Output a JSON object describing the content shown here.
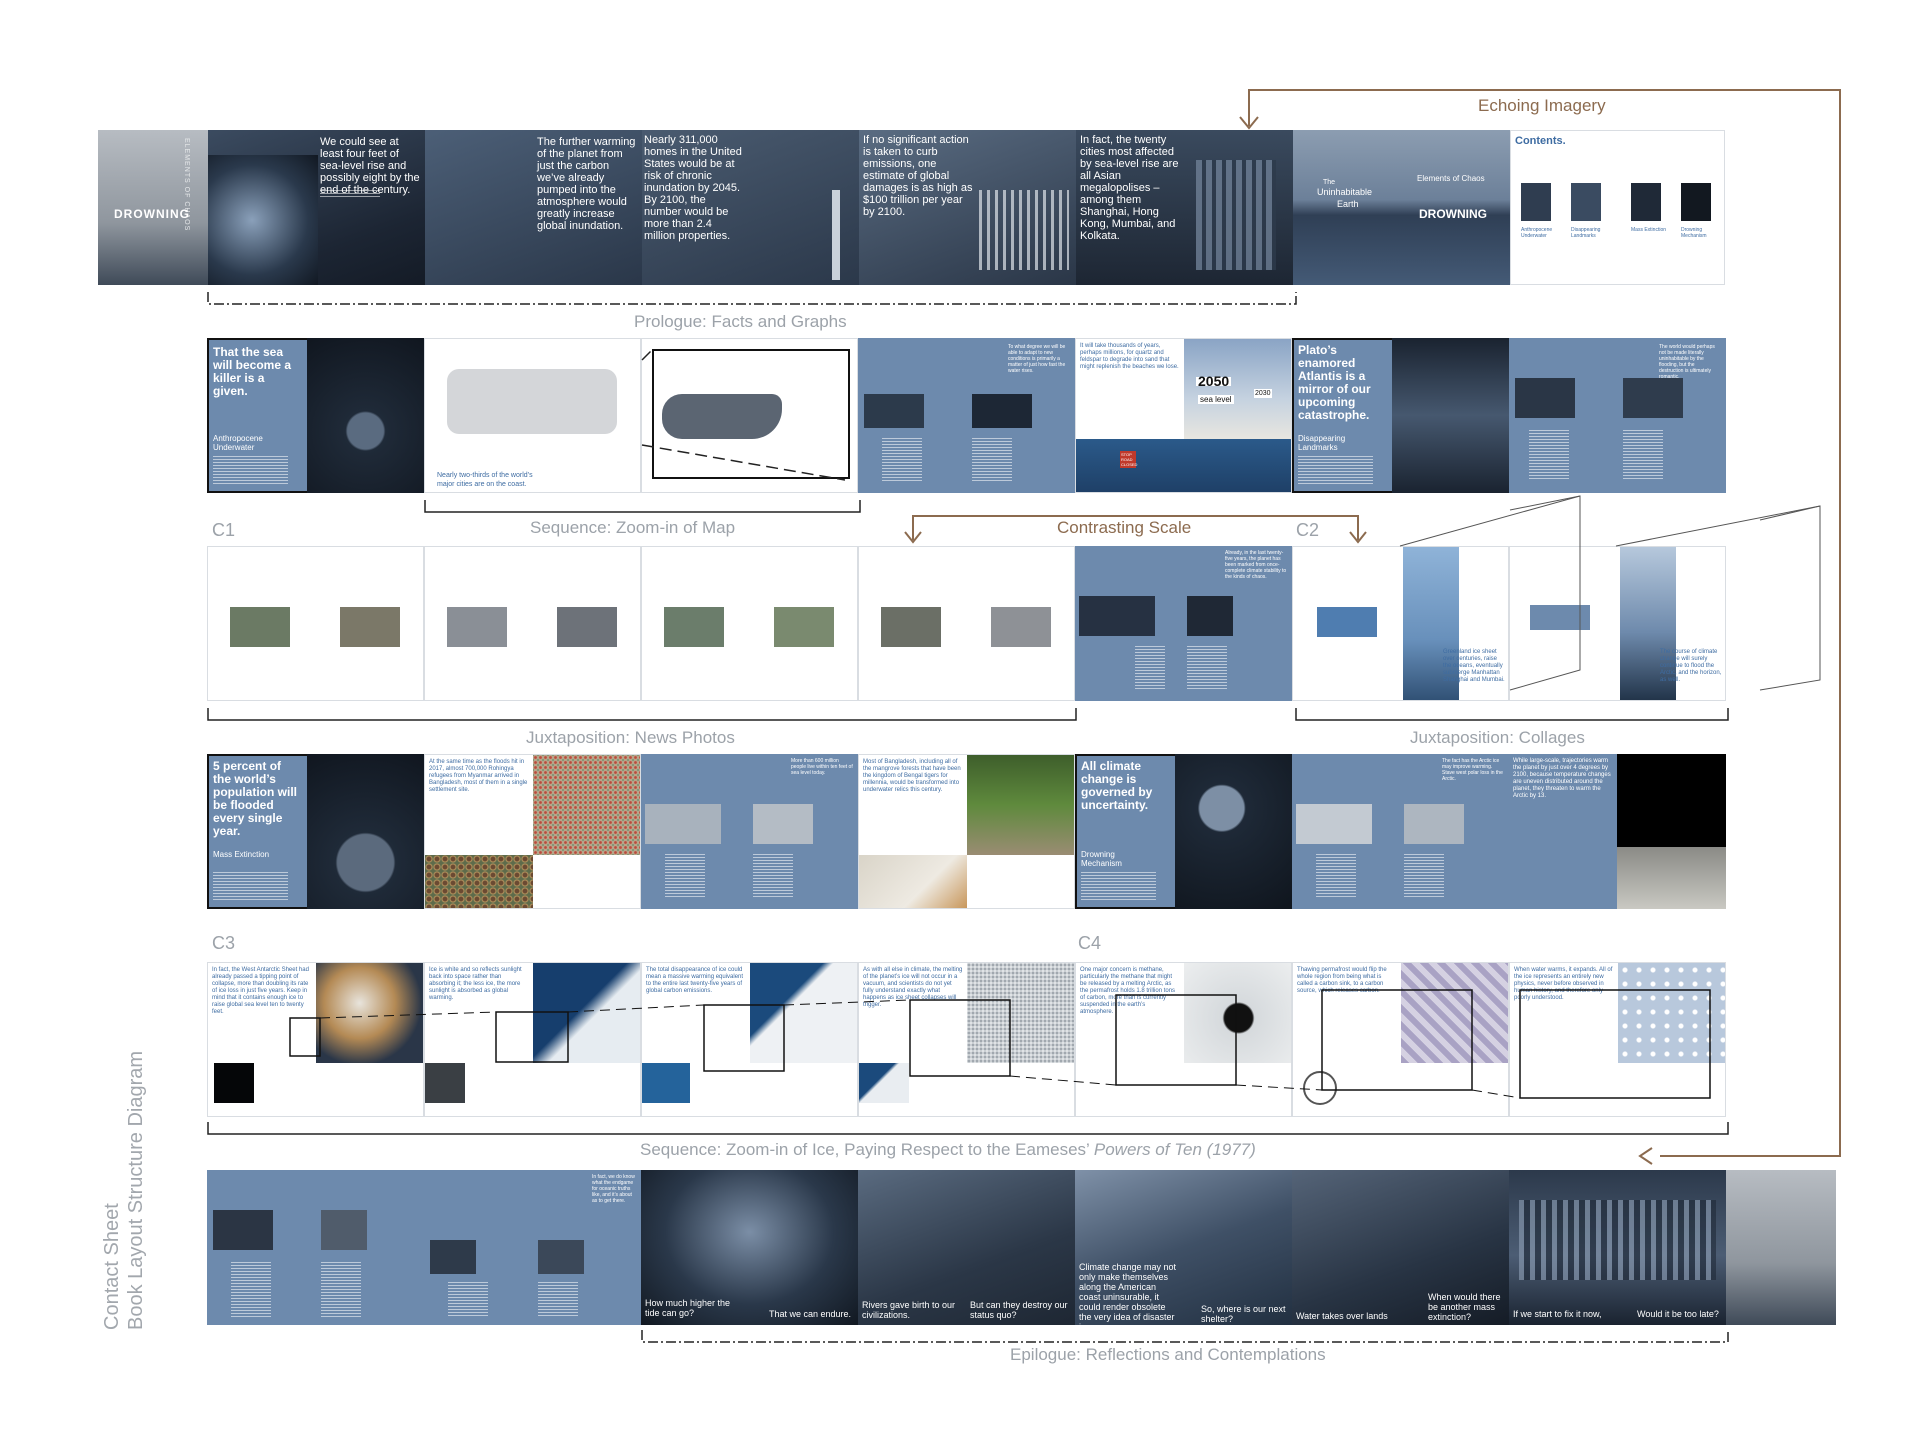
{
  "annotations": {
    "echoing_imagery": "Echoing Imagery",
    "prologue": "Prologue: Facts and Graphs",
    "sequence_map": "Sequence: Zoom-in of Map",
    "contrasting_scale": "Contrasting Scale",
    "juxtaposition_news": "Juxtaposition: News Photos",
    "juxtaposition_collages": "Juxtaposition: Collages",
    "sequence_ice_prefix": "Sequence: Zoom-in of Ice, Paying Respect to the Eameses’ ",
    "sequence_ice_italic": "Powers of Ten (1977)",
    "epilogue": "Epilogue: Reflections and Contemplations",
    "c1": "C1",
    "c2": "C2",
    "c3": "C3",
    "c4": "C4",
    "side_title_1": "Contact Sheet",
    "side_title_2": "Book Layout Structure Diagram"
  },
  "colors": {
    "page_blue": "#6d8aad",
    "annotation_brown": "#8c6b4f",
    "label_grey": "#9ca2a9"
  },
  "row1": {
    "cover_vertical": "ELEMENTS OF CHAOS",
    "cover_title": "DROWNING",
    "p2": "We could see at least four feet of sea-level rise and possibly eight by the end of the century.",
    "p3": "The further warming of the planet from just the carbon we’ve already pumped into the atmosphere would greatly increase global inundation.",
    "p4": "Nearly 311,000 homes in the United States would be at risk of chronic inundation by 2045. By 2100, the number would be more than 2.4 million properties.",
    "p5": "If no significant action is taken to curb emissions, one estimate of global damages is as high as $100 trillion per year by 2100.",
    "p6": "In fact, the twenty cities most affected by sea-level rise are all Asian megalopolises – among them Shanghai, Hong Kong, Mumbai, and Kolkata.",
    "title_left_1": "The",
    "title_left_2": "Uninhabitable",
    "title_left_3": "Earth",
    "title_right_1": "Elements of Chaos",
    "title_right_2": "DROWNING",
    "contents": "Contents.",
    "contents_items": [
      "Anthropocene Underwater",
      "Disappearing Landmarks",
      "Mass Extinction",
      "Drowning Mechanism"
    ]
  },
  "row2": {
    "c1_title": "That the sea will become a killer is a given.",
    "c1_sub": "Anthropocene Underwater",
    "map_caption": "Nearly two-thirds of the world’s major cities are on the coast.",
    "p5_text": "To what degree we will be able to adapt to new conditions is primarily a matter of just how fast the water rises.",
    "p6_text": "It will take thousands of years, perhaps millions, for quartz and feldspar to degrade into sand that might replenish the beaches we lose.",
    "sign_year": "2050",
    "sign_sub": "sea level",
    "sign_small": "2030",
    "stop_sign": "STOP ROAD CLOSED",
    "c2_title": "Plato’s enamored Atlantis is a mirror of our upcoming catastrophe.",
    "c2_sub": "Disappearing Landmarks",
    "p8_text": "The world would perhaps not be made literally uninhabitable by the flooding, but the destruction is ultimately romantic."
  },
  "row3": {
    "p6_text": "Already, in the last twenty-five years, the planet has been marked from once-complete climate stability to the kinds of chaos.",
    "p7_text": "Greenland ice sheet over centuries, raise the oceans, eventually submerge Manhattan Shanghai and Mumbai.",
    "p8_text": "The course of climate change will surely continue to flood the Arctic, and the horizon, as well."
  },
  "row4": {
    "c3_title": "5 percent of the world’s population will be flooded every single year.",
    "c3_sub": "Mass Extinction",
    "p2_text": "At the same time as the floods hit in 2017, almost 700,000 Rohingya refugees from Myanmar arrived in Bangladesh, most of them in a single settlement site.",
    "p3_text": "More than 600 million people live within ten feet of sea level today.",
    "p4_text": "Most of Bangladesh, including all of the mangrove forests that have been the kingdom of Bengal tigers for millennia, would be transformed into underwater relics this century.",
    "c4_title": "All climate change is governed by uncertainty.",
    "c4_sub": "Drowning Mechanism",
    "p7_text": "The fact has the Arctic ice may improve warming. Stave west polar loss in the Arctic.",
    "p8_text": "While large-scale, trajectories warm the planet by just over 4 degrees by 2100, because temperature changes are uneven distributed around the planet, they threaten to warm the Arctic by 13."
  },
  "row5": {
    "p1_text": "In fact, the West Antarctic Sheet had already passed a tipping point of collapse, more than doubling its rate of ice loss in just five years. Keep in mind that it contains enough ice to raise global sea level ten to twenty feet.",
    "p2_text": "Ice is white and so reflects sunlight back into space rather than absorbing it; the less ice, the more sunlight is absorbed as global warming.",
    "p3_text": "The total disappearance of ice could mean a massive warming equivalent to the entire last twenty-five years of global carbon emissions.",
    "p4_text": "As with all else in climate, the melting of the planet’s ice will not occur in a vacuum, and scientists do not yet fully understand exactly what happens as ice sheet collapses will trigger.",
    "p5_text": "One major concern is methane, particularly the methane that might be released by a melting Arctic, as the permafrost holds 1.8 trillion tons of carbon, more than is currently suspended in the earth’s atmosphere.",
    "p6_text": "Thawing permafrost would flip the whole region from being what is called a carbon sink, to a carbon source, which releases carbon.",
    "p7_text": "When water warms, it expands. All of the ice represents an entirely new physics, never before observed in human history, and therefore only poorly understood."
  },
  "row6": {
    "p2_text": "In fact, we do know what the endgame for oceanic truths like, and it’s about as to get there.",
    "q1a": "How much higher the tide can go?",
    "q1b": "That we can endure.",
    "q2a": "Rivers gave birth to our civilizations.",
    "q2b": "But can they destroy our status quo?",
    "q3a": "Climate change may not only make themselves along the American coast uninsurable, it could render obsolete the very idea of disaster insurance.",
    "q3b": "So, where is our next shelter?",
    "q4a": "Water takes over lands",
    "q4b": "When would there be another mass extinction?",
    "q5a": "If we start to fix it now,",
    "q5b": "Would it be too late?"
  }
}
